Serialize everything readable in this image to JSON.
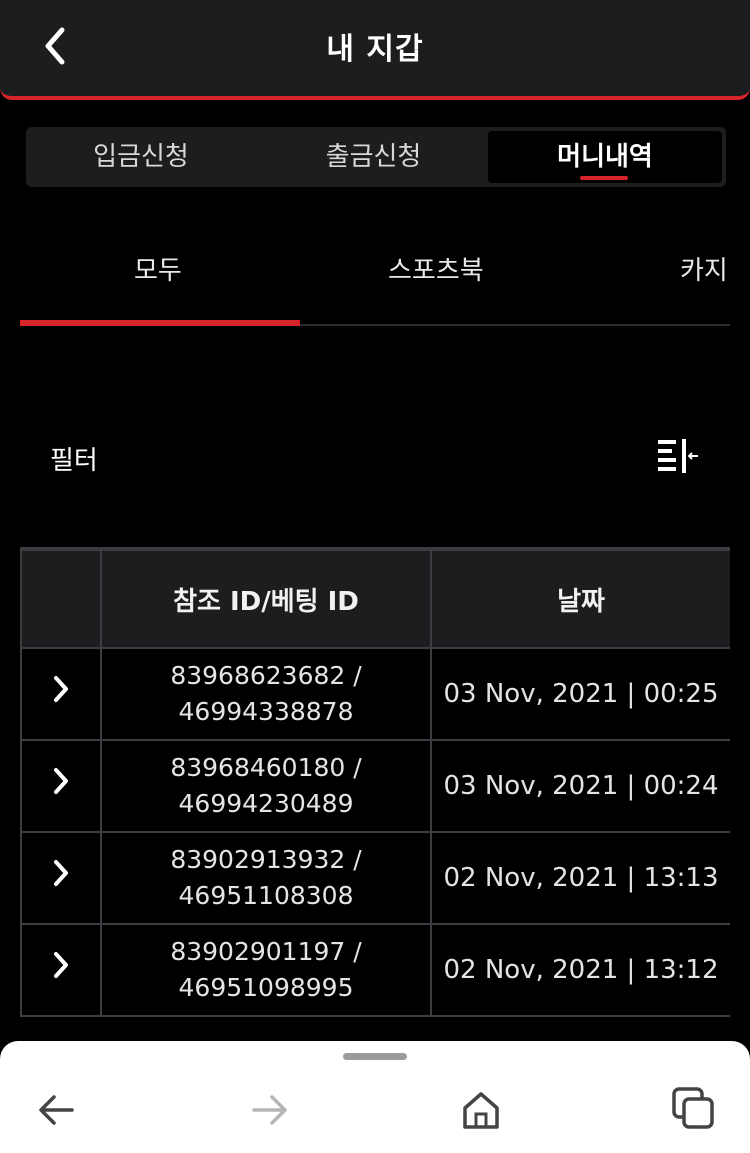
{
  "header": {
    "title": "내 지갑",
    "back_icon": "chevron-left-icon"
  },
  "segment_tabs": [
    {
      "label": "입금신청",
      "active": false
    },
    {
      "label": "출금신청",
      "active": false
    },
    {
      "label": "머니내역",
      "active": true
    }
  ],
  "category_tabs": [
    {
      "label": "모두",
      "active": true
    },
    {
      "label": "스포츠북",
      "active": false
    },
    {
      "label": "카지"
    }
  ],
  "filter": {
    "label": "필터",
    "icon": "filter-collapse-icon"
  },
  "table": {
    "columns": [
      "",
      "참조 ID/베팅 ID",
      "날짜"
    ],
    "rows": [
      {
        "ref_id": "83968623682 /",
        "bet_id": "46994338878",
        "date": "03 Nov, 2021 | 00:25"
      },
      {
        "ref_id": "83968460180 /",
        "bet_id": "46994230489",
        "date": "03 Nov, 2021 | 00:24"
      },
      {
        "ref_id": "83902913932 /",
        "bet_id": "46951108308",
        "date": "02 Nov, 2021 | 13:13"
      },
      {
        "ref_id": "83902901197 /",
        "bet_id": "46951098995",
        "date": "02 Nov, 2021 | 13:12"
      }
    ]
  },
  "browser_nav": {
    "icons": [
      "arrow-back-icon",
      "arrow-forward-icon",
      "home-icon",
      "tabs-icon"
    ]
  },
  "colors": {
    "accent": "#d6262b",
    "background": "#000000",
    "panel": "#1c1d1f",
    "border": "#3c3d42"
  }
}
